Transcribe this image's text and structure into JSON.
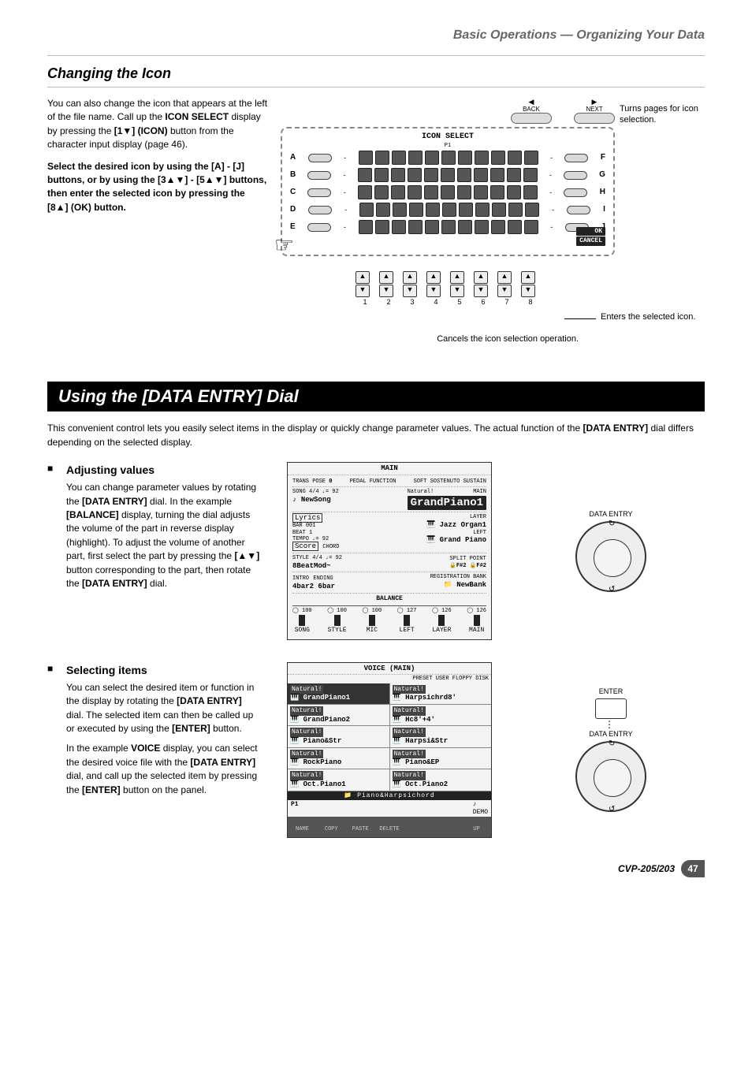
{
  "runningHead": "Basic Operations — Organizing Your Data",
  "section1": {
    "title": "Changing the Icon",
    "para1a": "You can also change the icon that appears at the left of the file name. Call up the ",
    "para1b": "ICON SELECT",
    "para1c": " display by pressing the ",
    "para1d": "[1▼] (ICON)",
    "para1e": " button from the character input display (page 46).",
    "para2a": "Select the desired icon by using the [A] - [J] buttons, or by using the [3▲▼] - [5▲▼] buttons, then enter the selected icon by pressing the [8▲] (OK) button.",
    "lcd": {
      "title": "ICON SELECT",
      "page": "P1",
      "leftLetters": [
        "A",
        "B",
        "C",
        "D",
        "E"
      ],
      "rightLetters": [
        "F",
        "G",
        "H",
        "I",
        "J"
      ],
      "ok": "OK",
      "cancel": "CANCEL",
      "btnNums": [
        "1",
        "2",
        "3",
        "4",
        "5",
        "6",
        "7",
        "8"
      ],
      "backLbl": "BACK",
      "nextLbl": "NEXT"
    },
    "annot1": "Turns pages for icon selection.",
    "annot2": "Enters the selected icon.",
    "annot3": "Cancels the icon selection operation."
  },
  "banner": "Using the [DATA ENTRY] Dial",
  "introA": "This convenient control lets you easily select items in the display or quickly change parameter values. The actual function of the ",
  "introB": "[DATA ENTRY]",
  "introC": " dial differs depending on the selected display.",
  "sub1": {
    "title": "Adjusting values",
    "p1a": "You can change parameter values by rotating the ",
    "p1b": "[DATA ENTRY]",
    "p1c": " dial. In the example ",
    "p1d": "[BALANCE]",
    "p1e": " display, turning the dial adjusts the volume of the part in reverse display (highlight). To adjust the volume of another part, first select the part by pressing the ",
    "p1f": "[▲▼]",
    "p1g": " button corresponding to the part, then rotate the ",
    "p1h": "[DATA ENTRY]",
    "p1i": " dial.",
    "screen": {
      "title": "MAIN",
      "trans": "TRANS POSE",
      "transVal": "0",
      "pedal": "PEDAL FUNCTION",
      "sust": "SOFT SOSTENUTO SUSTAIN",
      "songMeta": "SONG 4/4 ♩= 92",
      "song": "NewSong",
      "voiceCat": "Natural!",
      "voice": "GrandPiano1",
      "mainLbl": "MAIN",
      "lyrics": "Lyrics",
      "bar": "BAR",
      "barVal": "001",
      "beat": "BEAT",
      "beatVal": "1",
      "tempo": "TEMPO ♩= 92",
      "score": "Score",
      "chord": "CHORD",
      "layerLbl": "LAYER",
      "layer": "Jazz Organ1",
      "leftLbl": "LEFT",
      "left": "Grand Piano",
      "styleMeta": "STYLE 4/4 ♩= 92",
      "style": "8BeatMod~",
      "split": "SPLIT POINT",
      "splitA": "F#2",
      "splitB": "F#2",
      "intro": "INTRO",
      "introVal": "4bar2",
      "ending": "ENDING",
      "endingVal": "6bar",
      "regLbl": "REGISTRATION BANK",
      "reg": "NewBank",
      "balance": "BALANCE",
      "balCols": [
        "SONG",
        "STYLE",
        "MIC",
        "LEFT",
        "LAYER",
        "MAIN"
      ],
      "balVals": [
        "100",
        "100",
        "100",
        "127",
        "126",
        "126"
      ]
    },
    "dialLbl": "DATA ENTRY"
  },
  "sub2": {
    "title": "Selecting items",
    "p1a": "You can select the desired item or function in the display by rotating the ",
    "p1b": "[DATA ENTRY]",
    "p1c": " dial. The selected item can then be called up or executed by using the ",
    "p1d": "[ENTER]",
    "p1e": " button.",
    "p2a": "In the example ",
    "p2b": "VOICE",
    "p2c": " display, you can select the desired voice file with the ",
    "p2d": "[DATA ENTRY]",
    "p2e": " dial, and call up the selected item by pressing the ",
    "p2f": "[ENTER]",
    "p2g": " button on the panel.",
    "screen": {
      "title": "VOICE (MAIN)",
      "tabs": "PRESET  USER  FLOPPY DISK",
      "cat": "Natural!",
      "items": [
        [
          "GrandPiano1",
          "Harpsichrd8'"
        ],
        [
          "GrandPiano2",
          "Hc8'+4'"
        ],
        [
          "Piano&Str",
          "Harpsi&Str"
        ],
        [
          "RockPiano",
          "Piano&EP"
        ],
        [
          "Oct.Piano1",
          "Oct.Piano2"
        ]
      ],
      "folder": "Piano&Harpsichord",
      "page": "P1",
      "footer": [
        "NAME",
        "COPY",
        "PASTE",
        "DELETE",
        "",
        "",
        "UP"
      ]
    },
    "enterLbl": "ENTER",
    "dialLbl": "DATA ENTRY"
  },
  "footer": {
    "model": "CVP-205/203",
    "page": "47"
  }
}
